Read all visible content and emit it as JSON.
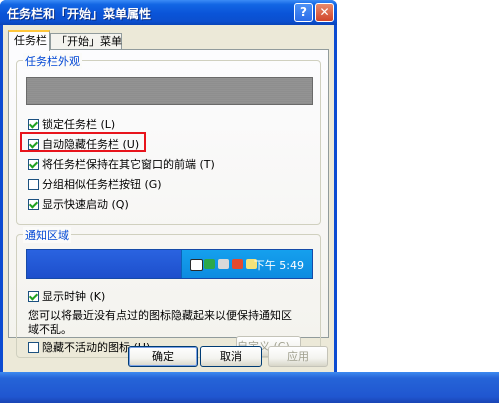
{
  "window": {
    "title": "任务栏和「开始」菜单属性",
    "help_label": "?",
    "close_label": "✕"
  },
  "tabs": [
    {
      "label": "任务栏",
      "active": true
    },
    {
      "label": "「开始」菜单",
      "active": false
    }
  ],
  "appearance": {
    "legend": "任务栏外观",
    "options": [
      {
        "label": "锁定任务栏 (L)",
        "checked": true
      },
      {
        "label": "自动隐藏任务栏 (U)",
        "checked": true,
        "highlighted": true
      },
      {
        "label": "将任务栏保持在其它窗口的前端 (T)",
        "checked": true
      },
      {
        "label": "分组相似任务栏按钮 (G)",
        "checked": false
      },
      {
        "label": "显示快速启动 (Q)",
        "checked": true
      }
    ]
  },
  "notification": {
    "legend": "通知区域",
    "tray_time": "下午 5:49",
    "show_clock_label": "显示时钟 (K)",
    "show_clock_checked": true,
    "description": "您可以将最近没有点过的图标隐藏起来以便保持通知区域不乱。",
    "hide_inactive_label": "隐藏不活动的图标 (H)",
    "hide_inactive_checked": false,
    "customize_label": "自定义 (C)..."
  },
  "buttons": {
    "ok": "确定",
    "cancel": "取消",
    "apply": "应用"
  },
  "colors": {
    "title_blue": "#0a54d8",
    "highlight_red": "#e8141c",
    "legend_blue": "#0046d5"
  }
}
